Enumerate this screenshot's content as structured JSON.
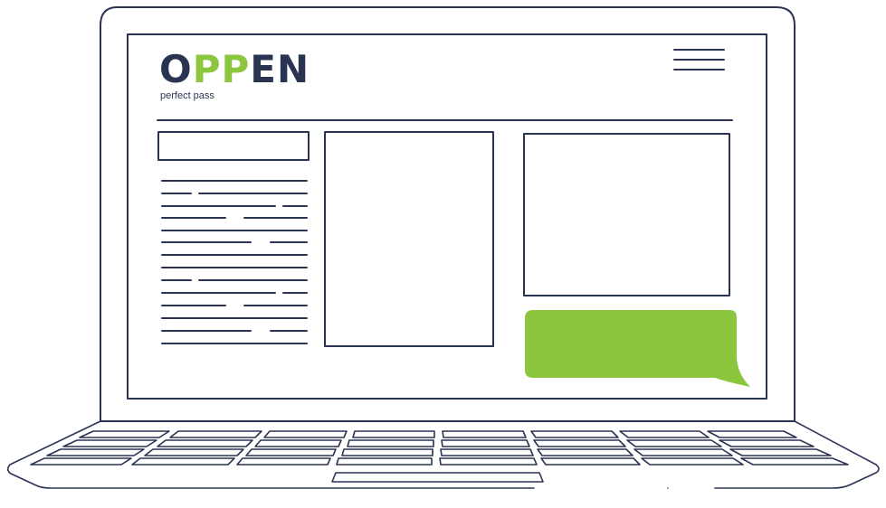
{
  "brand": {
    "name_parts": [
      "O",
      "PP",
      "EN"
    ],
    "tagline": "perfect pass"
  },
  "colors": {
    "outline": "#2b3353",
    "accent_green": "#8cc63f",
    "background": "#ffffff"
  },
  "icons": {
    "menu": "hamburger-menu-icon"
  }
}
